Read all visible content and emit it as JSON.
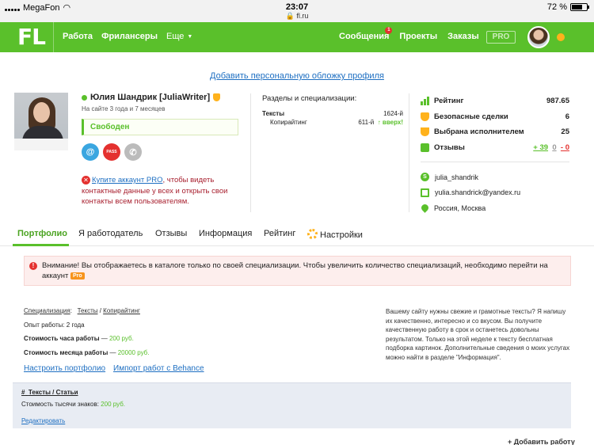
{
  "status_bar": {
    "carrier": "MegaFon",
    "time": "23:07",
    "url": "fl.ru",
    "battery": "72 %",
    "battery_level": 0.72
  },
  "nav": {
    "logo": "FL",
    "left_items": [
      "Работа",
      "Фрилансеры"
    ],
    "more_label": "Еще",
    "messages_label": "Сообщения",
    "messages_badge": "1",
    "projects_label": "Проекты",
    "orders_label": "Заказы",
    "pro_label": "PRO"
  },
  "cover_link": "Добавить персональную обложку профиля",
  "profile": {
    "name": "Юлия Шандрик [JuliaWriter]",
    "on_site": "На сайте 3 года и 7 месяцев",
    "status": "Свободен",
    "pass_label": "PASS",
    "at_label": "@",
    "buy_pro": {
      "icon": "✕",
      "link": "Купите аккаунт PRO",
      "text": ", чтобы видеть контактные данные у всех и открыть свои контакты всем пользователям."
    }
  },
  "specs": {
    "title": "Разделы и специализации:",
    "main_name": "Тексты",
    "main_rank": "1624-й",
    "sub_name": "Копирайтинг",
    "sub_rank": "611-й",
    "sub_trend": "↑ вверх!"
  },
  "stats": {
    "rating_label": "Рейтинг",
    "rating_value": "987.65",
    "safe_label": "Безопасные сделки",
    "safe_value": "6",
    "chosen_label": "Выбрана исполнителем",
    "chosen_value": "25",
    "reviews_label": "Отзывы",
    "reviews_pos": "+ 39",
    "reviews_neu": "0",
    "reviews_neg": "- 0"
  },
  "contacts": {
    "skype": "julia_shandrik",
    "email": "yulia.shandrick@yandex.ru",
    "location": "Россия, Москва"
  },
  "tabs": [
    "Портфолио",
    "Я работодатель",
    "Отзывы",
    "Информация",
    "Рейтинг",
    "Настройки"
  ],
  "warning": {
    "text": "Внимание! Вы отображаетесь в каталоге только по своей специализации. Чтобы увеличить количество специализаций, необходимо перейти на аккаунт",
    "tag": "Pro"
  },
  "portfolio_info": {
    "spec_label": "Специализация",
    "spec_value_1": "Тексты",
    "spec_value_2": "Копирайтинг",
    "experience": "Опыт работы:  2 года",
    "hour_label": "Стоимость часа работы",
    "hour_value": "200 руб.",
    "month_label": "Стоимость месяца работы",
    "month_value": "20000 руб.",
    "setup_link": "Настроить портфолио",
    "behance_link": "Импорт работ с Behance",
    "about": "Вашему сайту нужны свежие и грамотные тексты? Я напишу их качественно, интересно и со вкусом. Вы получите качественную работу в срок и останетесь довольны результатом. Только на этой неделе к тексту бесплатная подборка картинок. Дополнительные сведения о моих услугах можно найти в разделе \"Информация\"."
  },
  "section": {
    "hash": "#",
    "title": "Тексты / Статьи",
    "price_label": "Стоимость тысячи знаков:",
    "price_value": "200 руб.",
    "edit": "Редактировать"
  },
  "add_work": "+ Добавить работу",
  "colors": {
    "brand_green": "#5ac02b",
    "link_blue": "#1e6fc2",
    "warning_bg": "#fdeeed",
    "accent_orange": "#ffb21c"
  }
}
